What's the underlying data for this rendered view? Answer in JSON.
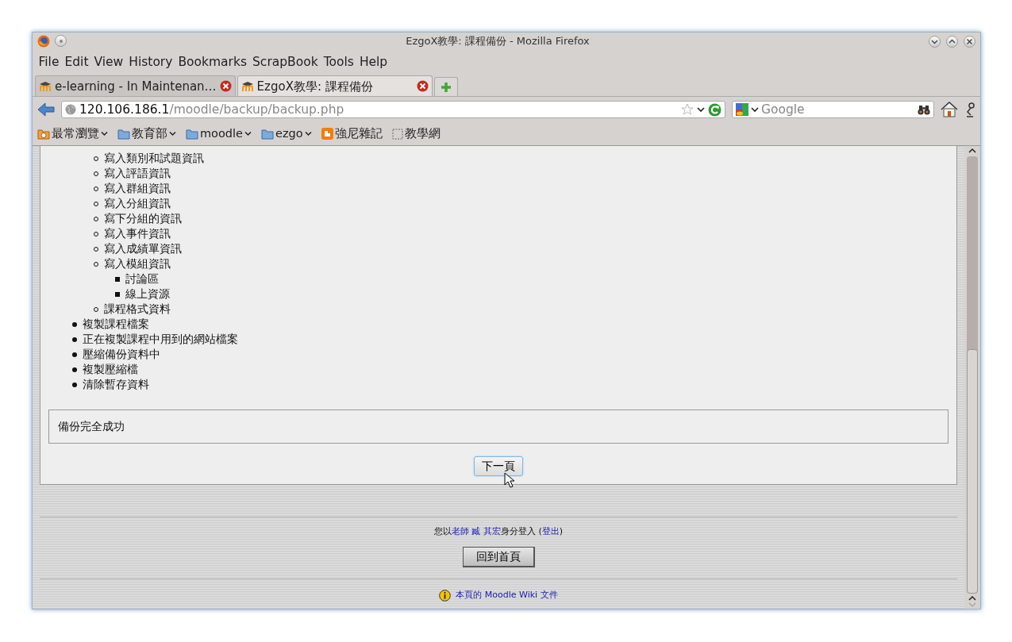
{
  "window": {
    "title": "EzgoX教學: 課程備份 - Mozilla Firefox"
  },
  "menu": [
    {
      "label": "File"
    },
    {
      "label": "Edit"
    },
    {
      "label": "View"
    },
    {
      "label": "History"
    },
    {
      "label": "Bookmarks"
    },
    {
      "label": "ScrapBook"
    },
    {
      "label": "Tools"
    },
    {
      "label": "Help"
    }
  ],
  "tabs": [
    {
      "label": "e-learning - In Maintenan…",
      "selected": false
    },
    {
      "label": "EzgoX教學: 課程備份",
      "selected": true
    }
  ],
  "address": {
    "host": "120.106.186.1",
    "path": "/moodle/backup/backup.php"
  },
  "search": {
    "placeholder": "Google"
  },
  "bookmarks": [
    {
      "label": "最常瀏覽",
      "kind": "smart",
      "dropdown": true
    },
    {
      "label": "教育部",
      "kind": "folder",
      "dropdown": true
    },
    {
      "label": "moodle",
      "kind": "folder",
      "dropdown": true
    },
    {
      "label": "ezgo",
      "kind": "folder",
      "dropdown": true
    },
    {
      "label": "強尼雜記",
      "kind": "blog",
      "dropdown": false
    },
    {
      "label": "教學網",
      "kind": "page",
      "dropdown": false
    }
  ],
  "steps": [
    {
      "children": [
        {
          "label": "寫入類別和試題資訊"
        },
        {
          "label": "寫入評語資訊"
        },
        {
          "label": "寫入群組資訊"
        },
        {
          "label": "寫入分組資訊"
        },
        {
          "label": "寫下分組的資訊"
        },
        {
          "label": "寫入事件資訊"
        },
        {
          "label": "寫入成績單資訊"
        },
        {
          "label": "寫入模組資訊",
          "children": [
            {
              "label": "討論區"
            },
            {
              "label": "線上資源"
            }
          ]
        },
        {
          "label": "課程格式資料"
        }
      ]
    },
    {
      "label": "複製課程檔案"
    },
    {
      "label": "正在複製課程中用到的網站檔案"
    },
    {
      "label": "壓縮備份資料中"
    },
    {
      "label": "複製壓縮檔"
    },
    {
      "label": "清除暫存資料"
    }
  ],
  "notice": "備份完全成功",
  "next_button": "下一頁",
  "login": {
    "prefix": "您以",
    "role": "老師",
    "user": "臧 其宏",
    "suffix": "身分登入 (",
    "logout": "登出",
    "close": ")"
  },
  "home_button": "回到首頁",
  "docs_link": "本頁的 Moodle Wiki 文件"
}
